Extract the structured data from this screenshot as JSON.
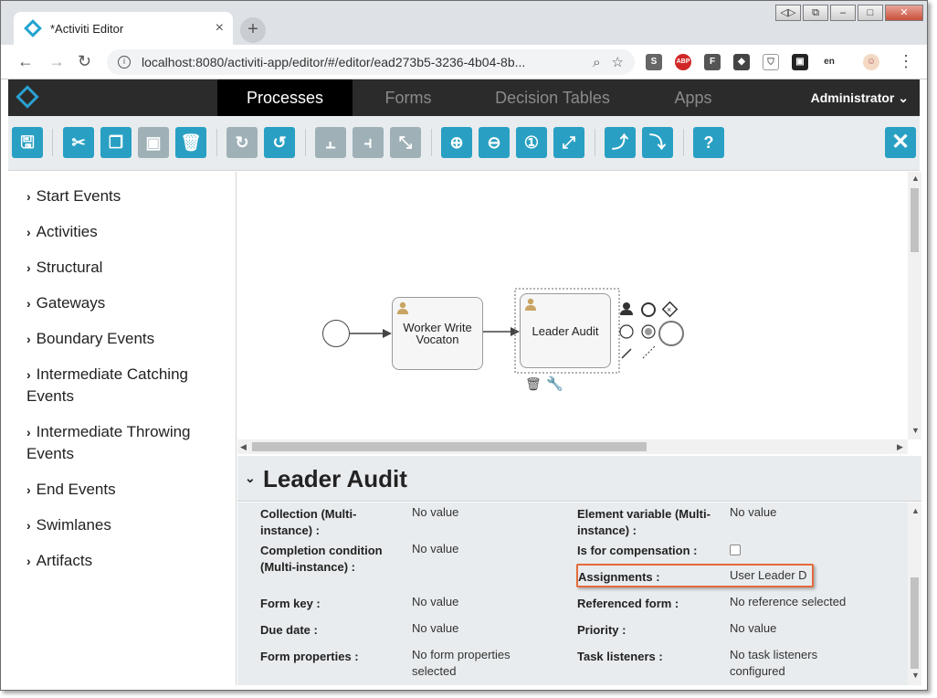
{
  "browser": {
    "tab_title": "*Activiti Editor",
    "tab_close": "×",
    "new_tab": "+",
    "url": "localhost:8080/activiti-app/editor/#/editor/ead273b5-3236-4b04-8b...",
    "extensions": [
      "S",
      "ABP",
      "F",
      "◆",
      "⛉",
      "▣",
      "en",
      "☺"
    ]
  },
  "app": {
    "nav_tabs": [
      "Processes",
      "Forms",
      "Decision Tables",
      "Apps"
    ],
    "active_tab": "Processes",
    "user_menu": "Administrator"
  },
  "palette": {
    "items": [
      "Start Events",
      "Activities",
      "Structural",
      "Gateways",
      "Boundary Events",
      "Intermediate Catching Events",
      "Intermediate Throwing Events",
      "End Events",
      "Swimlanes",
      "Artifacts"
    ]
  },
  "diagram": {
    "task1": "Worker Write Vocaton",
    "task2": "Leader Audit"
  },
  "properties": {
    "title": "Leader Audit",
    "left": [
      {
        "label": "Collection (Multi-instance) :",
        "value": "No value"
      },
      {
        "label": "Completion condition (Multi-instance) :",
        "value": "No value"
      },
      {
        "label": "Form key :",
        "value": "No value"
      },
      {
        "label": "Due date :",
        "value": "No value"
      },
      {
        "label": "Form properties :",
        "value": "No form properties selected"
      }
    ],
    "right": [
      {
        "label": "Element variable (Multi-instance) :",
        "value": "No value"
      },
      {
        "label": "Is for compensation :",
        "value": ""
      },
      {
        "label": "Assignments :",
        "value": "User Leader D"
      },
      {
        "label": "Referenced form :",
        "value": "No reference selected"
      },
      {
        "label": "Priority :",
        "value": "No value"
      },
      {
        "label": "Task listeners :",
        "value": "No task listeners configured"
      }
    ]
  },
  "colors": {
    "accent": "#29a0c3",
    "header_bg": "#2b2b2b",
    "highlight": "#e46a3b"
  }
}
